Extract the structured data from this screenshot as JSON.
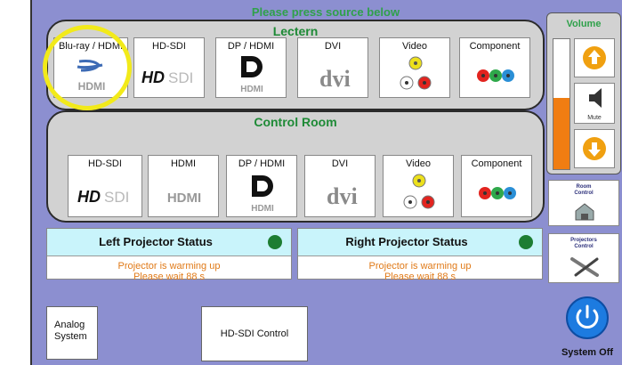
{
  "header": {
    "title": "Please press source below"
  },
  "lectern": {
    "label": "Lectern",
    "sources": [
      {
        "label": "Blu-ray / HDMI",
        "icon": "bluray-hdmi-icon"
      },
      {
        "label": "HD-SDI",
        "icon": "hd-sdi-icon"
      },
      {
        "label": "DP / HDMI",
        "icon": "displayport-hdmi-icon"
      },
      {
        "label": "DVI",
        "icon": "dvi-icon"
      },
      {
        "label": "Video",
        "icon": "composite-video-icon"
      },
      {
        "label": "Component",
        "icon": "component-video-icon"
      }
    ]
  },
  "control_room": {
    "label": "Control Room",
    "sources": [
      {
        "label": "HD-SDI",
        "icon": "hd-sdi-icon"
      },
      {
        "label": "HDMI",
        "icon": "hdmi-icon"
      },
      {
        "label": "DP / HDMI",
        "icon": "displayport-hdmi-icon"
      },
      {
        "label": "DVI",
        "icon": "dvi-icon"
      },
      {
        "label": "Video",
        "icon": "composite-video-icon"
      },
      {
        "label": "Component",
        "icon": "component-video-icon"
      }
    ]
  },
  "left_status": {
    "title": "Left Projector Status",
    "line1": "Projector is warming up",
    "line2": "Please wait  88  s"
  },
  "right_status": {
    "title": "Right Projector Status",
    "line1": "Projector is warming up",
    "line2": "Please wait  88  s"
  },
  "buttons": {
    "analog_line1": "Analog",
    "analog_line2": "System",
    "hdsdi_control": "HD-SDI Control"
  },
  "volume": {
    "label": "Volume",
    "mute_label": "Mute",
    "level": 0.55
  },
  "side": {
    "room_control_line1": "Room",
    "room_control_line2": "Control",
    "projectors_control_line1": "Projectors",
    "projectors_control_line2": "Control",
    "system_off": "System Off"
  },
  "colors": {
    "panel_bg": "#8c8fd0",
    "title_green": "#2fa14a",
    "status_orange": "#e07a18",
    "led_green": "#1d7d32",
    "selection_ring": "#f2ea1a",
    "volume_orange": "#f07d12",
    "power_blue": "#1d7be0"
  }
}
